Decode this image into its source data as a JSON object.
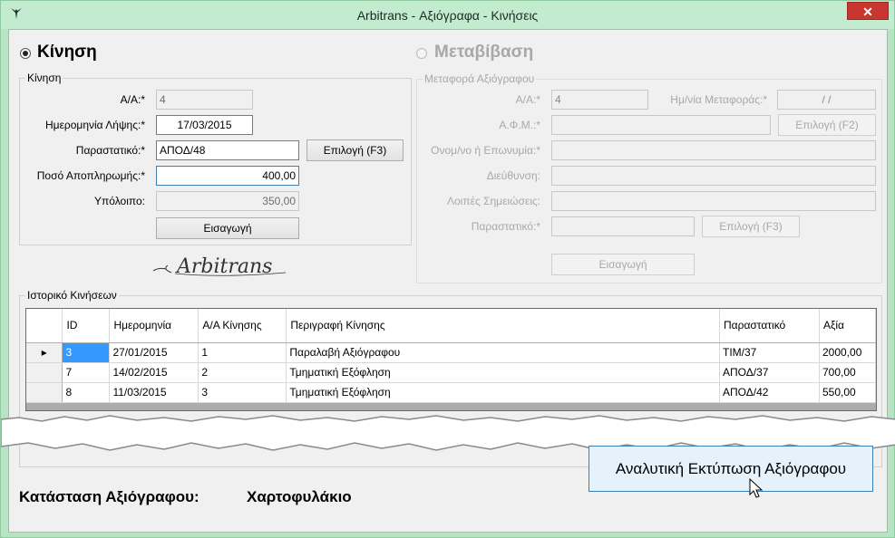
{
  "window": {
    "title": "Arbitrans - Αξιόγραφα - Κινήσεις",
    "close_label": "✕"
  },
  "modes": {
    "kinisi_label": "Κίνηση",
    "metavasi_label": "Μεταβίβαση",
    "selected": "kinisi"
  },
  "kinisi_group": {
    "legend": "Κίνηση",
    "aa_label": "Α/Α:*",
    "aa_value": "4",
    "date_label": "Ημερομηνία Λήψης:*",
    "date_value": "17/03/2015",
    "doc_label": "Παραστατικό:*",
    "doc_value": "ΑΠΟΔ/48",
    "doc_button": "Επιλογή (F3)",
    "amount_label": "Ποσό Αποπληρωμής:*",
    "amount_value": "400,00",
    "balance_label": "Υπόλοιπο:",
    "balance_value": "350,00",
    "insert_button": "Εισαγωγή"
  },
  "logo": {
    "text": "Arbitrans"
  },
  "transfer_group": {
    "legend": "Μεταφορά Αξιόγραφου",
    "aa_label": "Α/Α:*",
    "aa_value": "4",
    "transfer_date_label": "Ημ/νία Μεταφοράς:*",
    "transfer_date_value": " /  /",
    "afm_label": "Α.Φ.Μ.:*",
    "afm_button": "Επιλογή (F2)",
    "name_label": "Ονομ/νο ή Επωνυμία:*",
    "address_label": "Διεύθυνση:",
    "notes_label": "Λοιπές Σημειώσεις:",
    "doc_label": "Παραστατικό:*",
    "doc_button": "Επιλογή (F3)",
    "insert_button": "Εισαγωγή"
  },
  "history": {
    "legend": "Ιστορικό Κινήσεων",
    "columns": [
      "ID",
      "Ημερομηνία",
      "Α/Α Κίνησης",
      "Περιγραφή Κίνησης",
      "Παραστατικό",
      "Αξία"
    ],
    "rows": [
      {
        "id": "3",
        "date": "27/01/2015",
        "aa": "1",
        "desc": "Παραλαβή Αξιόγραφου",
        "doc": "ΤΙΜ/37",
        "value": "2000,00",
        "current": true
      },
      {
        "id": "7",
        "date": "14/02/2015",
        "aa": "2",
        "desc": "Τμηματική Εξόφληση",
        "doc": "ΑΠΟΔ/37",
        "value": "700,00",
        "current": false
      },
      {
        "id": "8",
        "date": "11/03/2015",
        "aa": "3",
        "desc": "Τμηματική Εξόφληση",
        "doc": "ΑΠΟΔ/42",
        "value": "550,00",
        "current": false
      }
    ]
  },
  "status": {
    "label": "Κατάσταση Αξιόγραφου:",
    "value": "Χαρτοφυλάκιο"
  },
  "print_button": "Αναλυτική Εκτύπωση Αξιόγραφου",
  "colors": {
    "titlebar": "#c3ebd0",
    "close": "#c7372f",
    "selection": "#3399ff",
    "print_button_bg": "#e5f1fb",
    "print_button_border": "#3c7fb1"
  }
}
